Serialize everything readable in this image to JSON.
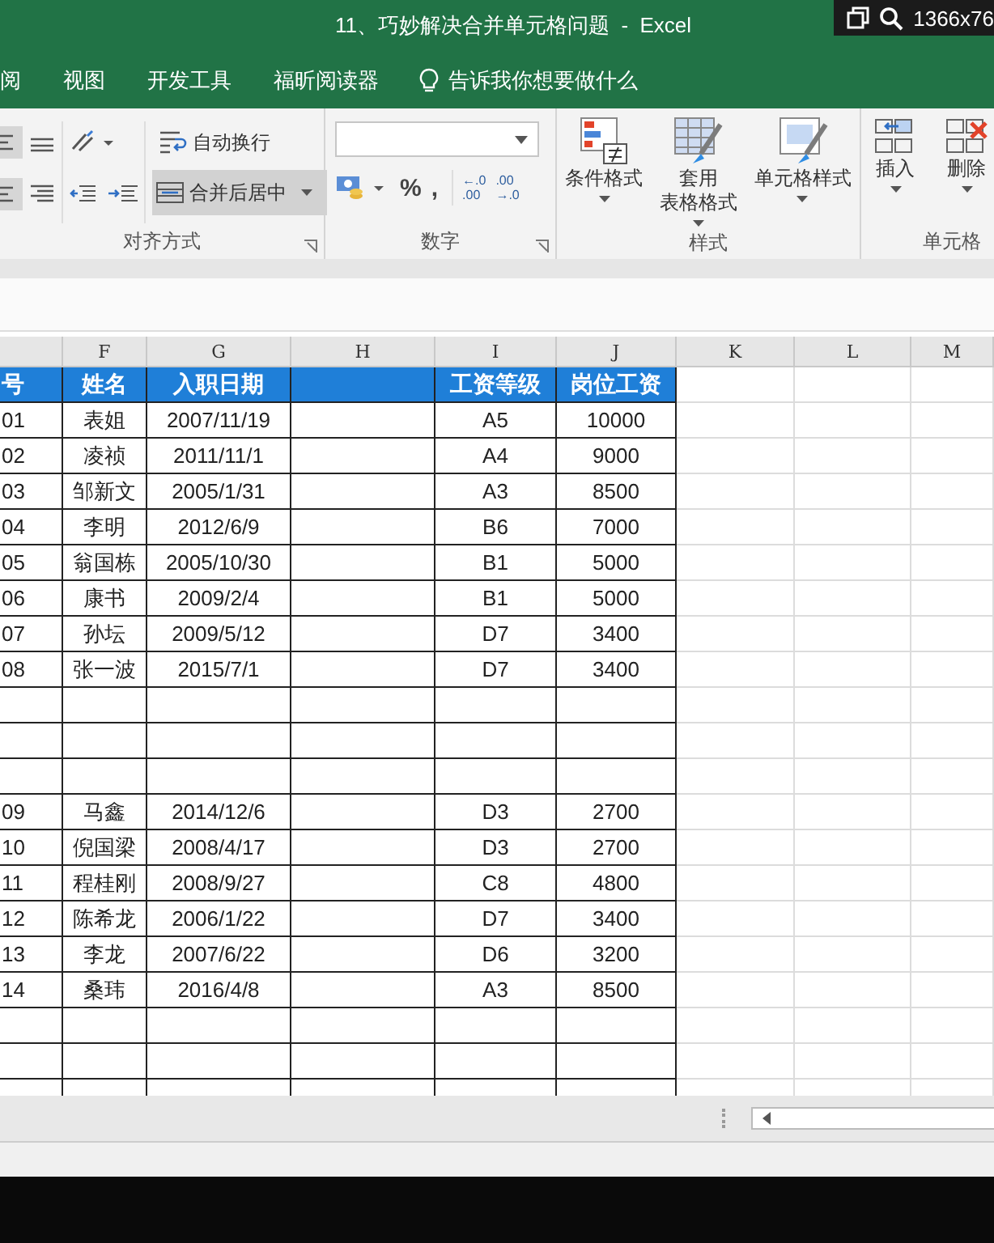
{
  "window": {
    "title": "11、巧妙解决合并单元格问题  -  Excel"
  },
  "overlay": {
    "resolution": "1366x76"
  },
  "ribbon_tabs": [
    {
      "label": "阅"
    },
    {
      "label": "视图"
    },
    {
      "label": "开发工具"
    },
    {
      "label": "福昕阅读器"
    }
  ],
  "tell_me": "告诉我你想要做什么",
  "alignment": {
    "wrap_text": "自动换行",
    "merge_center": {
      "label": "合并后居中",
      "selected": true
    },
    "group": "对齐方式"
  },
  "number": {
    "percent": "%",
    "comma": ",",
    "decimals": [
      {
        "top": "←.0",
        "bottom": ".00"
      },
      {
        "top": ".00",
        "bottom": "→.0"
      }
    ],
    "group": "数字"
  },
  "styles": {
    "buttons": [
      {
        "lines": [
          "条件格式"
        ],
        "kind": "conditional"
      },
      {
        "lines": [
          "套用",
          "表格格式"
        ],
        "kind": "table"
      },
      {
        "lines": [
          "单元格样式"
        ],
        "kind": "cell"
      }
    ],
    "group": "样式"
  },
  "cells": {
    "buttons": [
      {
        "label": "插入",
        "kind": "insert"
      },
      {
        "label": "删除",
        "kind": "delete"
      }
    ],
    "group": "单元格"
  },
  "columns": [
    "F",
    "G",
    "H",
    "I",
    "J",
    "K",
    "L",
    "M"
  ],
  "table": {
    "header": {
      "id": "号",
      "name": "姓名",
      "date": "入职日期",
      "grade": "工资等级",
      "salary": "岗位工资"
    },
    "rows": [
      {
        "kind": "data",
        "id": "01",
        "name": "表姐",
        "date": "2007/11/19",
        "grade": "A5",
        "salary": "10000"
      },
      {
        "kind": "data",
        "id": "02",
        "name": "凌祯",
        "date": "2011/11/1",
        "grade": "A4",
        "salary": "9000"
      },
      {
        "kind": "data",
        "id": "03",
        "name": "邹新文",
        "date": "2005/1/31",
        "grade": "A3",
        "salary": "8500"
      },
      {
        "kind": "data",
        "id": "04",
        "name": "李明",
        "date": "2012/6/9",
        "grade": "B6",
        "salary": "7000"
      },
      {
        "kind": "data",
        "id": "05",
        "name": "翁国栋",
        "date": "2005/10/30",
        "grade": "B1",
        "salary": "5000"
      },
      {
        "kind": "data",
        "id": "06",
        "name": "康书",
        "date": "2009/2/4",
        "grade": "B1",
        "salary": "5000"
      },
      {
        "kind": "data",
        "id": "07",
        "name": "孙坛",
        "date": "2009/5/12",
        "grade": "D7",
        "salary": "3400"
      },
      {
        "kind": "data",
        "id": "08",
        "name": "张一波",
        "date": "2015/7/1",
        "grade": "D7",
        "salary": "3400"
      },
      {
        "kind": "blank"
      },
      {
        "kind": "blank"
      },
      {
        "kind": "blank"
      },
      {
        "kind": "data",
        "id": "09",
        "name": "马鑫",
        "date": "2014/12/6",
        "grade": "D3",
        "salary": "2700"
      },
      {
        "kind": "data",
        "id": "10",
        "name": "倪国梁",
        "date": "2008/4/17",
        "grade": "D3",
        "salary": "2700"
      },
      {
        "kind": "data",
        "id": "11",
        "name": "程桂刚",
        "date": "2008/9/27",
        "grade": "C8",
        "salary": "4800"
      },
      {
        "kind": "data",
        "id": "12",
        "name": "陈希龙",
        "date": "2006/1/22",
        "grade": "D7",
        "salary": "3400"
      },
      {
        "kind": "data",
        "id": "13",
        "name": "李龙",
        "date": "2007/6/22",
        "grade": "D6",
        "salary": "3200"
      },
      {
        "kind": "data",
        "id": "14",
        "name": "桑玮",
        "date": "2016/4/8",
        "grade": "A3",
        "salary": "8500"
      },
      {
        "kind": "blank"
      },
      {
        "kind": "blank"
      },
      {
        "kind": "blank"
      }
    ]
  }
}
